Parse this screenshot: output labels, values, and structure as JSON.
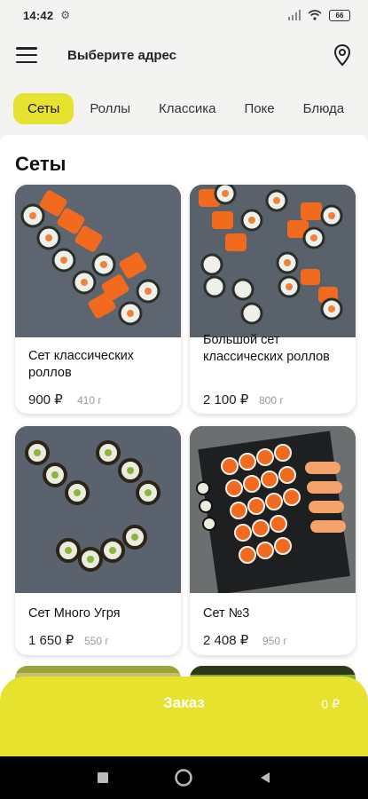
{
  "status": {
    "time": "14:42",
    "battery": "66"
  },
  "header": {
    "address_label": "Выберите адрес"
  },
  "tabs": [
    {
      "label": "Сеты",
      "active": true
    },
    {
      "label": "Роллы",
      "active": false
    },
    {
      "label": "Классика",
      "active": false
    },
    {
      "label": "Поке",
      "active": false
    },
    {
      "label": "Блюда",
      "active": false
    }
  ],
  "section": {
    "title": "Сеты"
  },
  "products": [
    {
      "name": "Сет классических роллов",
      "price": "900 ₽",
      "weight": "410 г"
    },
    {
      "name": "Большой сет классических роллов",
      "price": "2 100 ₽",
      "weight": "800 г"
    },
    {
      "name": "Сет Много Угря",
      "price": "1 650 ₽",
      "weight": "550 г"
    },
    {
      "name": "Сет №3",
      "price": "2 408 ₽",
      "weight": "950 г"
    }
  ],
  "order": {
    "label": "Заказ",
    "total": "0 ₽"
  },
  "colors": {
    "accent": "#e6e22d",
    "background": "#f3f3f1",
    "card": "#ffffff"
  }
}
